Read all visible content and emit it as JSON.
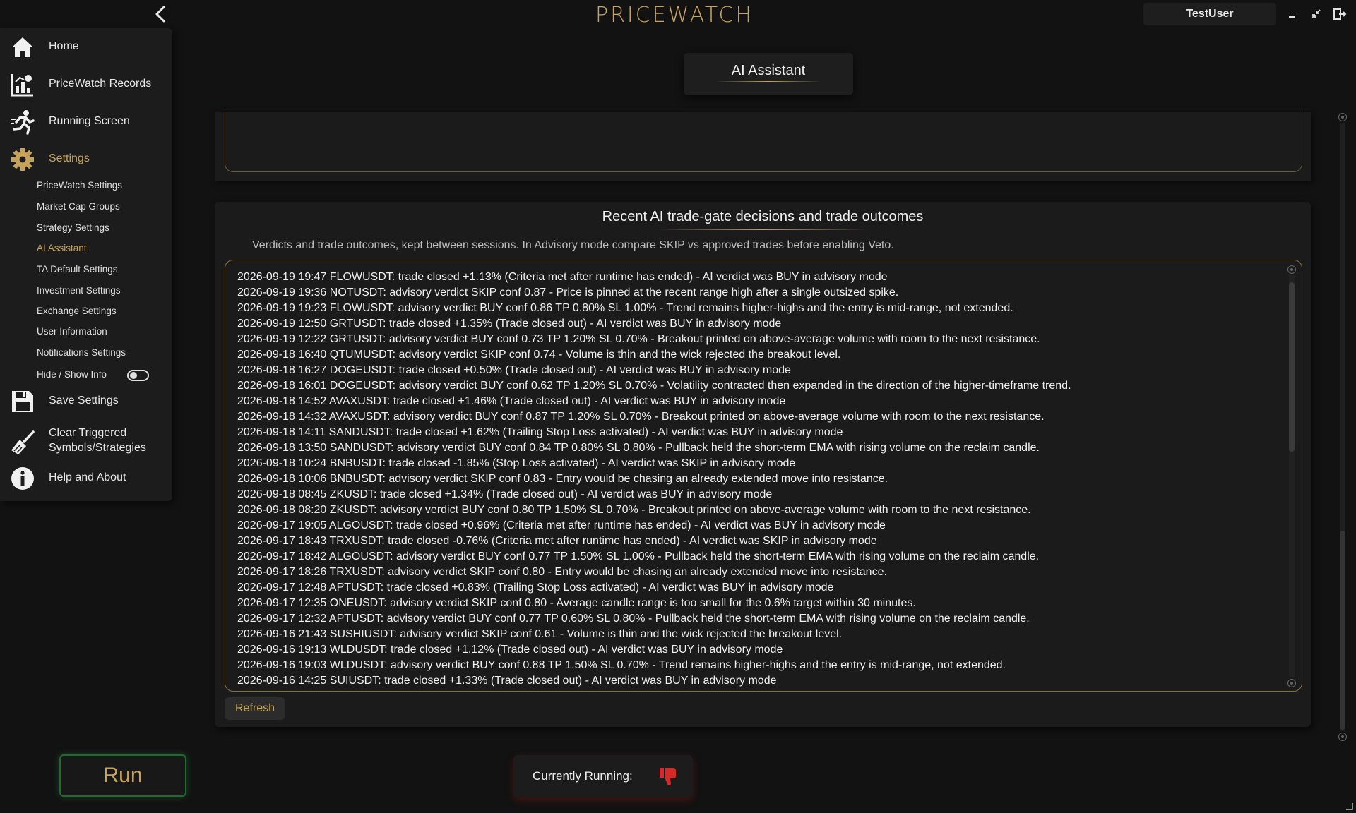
{
  "app": {
    "title": "PRICEWATCH",
    "user": "TestUser"
  },
  "sidebar": {
    "items": [
      {
        "label": "Home",
        "icon": "home-icon"
      },
      {
        "label": "PriceWatch Records",
        "icon": "records-chart-icon"
      },
      {
        "label": "Running Screen",
        "icon": "running-person-icon"
      },
      {
        "label": "Settings",
        "icon": "gear-icon"
      }
    ],
    "settings_subitems": [
      "PriceWatch Settings",
      "Market Cap Groups",
      "Strategy Settings",
      "AI Assistant",
      "TA Default Settings",
      "Investment Settings",
      "Exchange Settings",
      "User Information",
      "Notifications Settings"
    ],
    "active_subitem": "AI Assistant",
    "hide_show_label": "Hide / Show Info",
    "hide_show_state": "off",
    "save_label": "Save Settings",
    "clear_label_line1": "Clear Triggered",
    "clear_label_line2": "Symbols/Strategies",
    "help_label": "Help and About"
  },
  "page": {
    "title": "AI Assistant"
  },
  "log": {
    "title": "Recent AI trade-gate decisions and trade outcomes",
    "subtitle": "Verdicts and trade outcomes, kept between sessions. In Advisory mode compare SKIP vs approved trades before enabling Veto.",
    "lines": [
      "2026-09-19 19:47  FLOWUSDT: trade closed +1.13% (Criteria met after runtime has ended) - AI verdict was BUY in advisory mode",
      "2026-09-19 19:36  NOTUSDT: advisory verdict SKIP conf 0.87 - Price is pinned at the recent range high after a single outsized spike.",
      "2026-09-19 19:23  FLOWUSDT: advisory verdict BUY conf 0.86 TP 0.80% SL 1.00% - Trend remains higher-highs and the entry is mid-range, not extended.",
      "2026-09-19 12:50  GRTUSDT: trade closed +1.35% (Trade closed out) - AI verdict was BUY in advisory mode",
      "2026-09-19 12:22  GRTUSDT: advisory verdict BUY conf 0.73 TP 1.20% SL 0.70% - Breakout printed on above-average volume with room to the next resistance.",
      "2026-09-18 16:40  QTUMUSDT: advisory verdict SKIP conf 0.74 - Volume is thin and the wick rejected the breakout level.",
      "2026-09-18 16:27  DOGEUSDT: trade closed +0.50% (Trade closed out) - AI verdict was BUY in advisory mode",
      "2026-09-18 16:01  DOGEUSDT: advisory verdict BUY conf 0.62 TP 1.20% SL 0.70% - Volatility contracted then expanded in the direction of the higher-timeframe trend.",
      "2026-09-18 14:52  AVAXUSDT: trade closed +1.46% (Trade closed out) - AI verdict was BUY in advisory mode",
      "2026-09-18 14:32  AVAXUSDT: advisory verdict BUY conf 0.87 TP 1.20% SL 0.70% - Breakout printed on above-average volume with room to the next resistance.",
      "2026-09-18 14:11  SANDUSDT: trade closed +1.62% (Trailing Stop Loss activated) - AI verdict was BUY in advisory mode",
      "2026-09-18 13:50  SANDUSDT: advisory verdict BUY conf 0.84 TP 0.80% SL 0.80% - Pullback held the short-term EMA with rising volume on the reclaim candle.",
      "2026-09-18 10:24  BNBUSDT: trade closed -1.85% (Stop Loss activated) - AI verdict was SKIP in advisory mode",
      "2026-09-18 10:06  BNBUSDT: advisory verdict SKIP conf 0.83 - Entry would be chasing an already extended move into resistance.",
      "2026-09-18 08:45  ZKUSDT: trade closed +1.34% (Trade closed out) - AI verdict was BUY in advisory mode",
      "2026-09-18 08:20  ZKUSDT: advisory verdict BUY conf 0.80 TP 1.50% SL 0.70% - Breakout printed on above-average volume with room to the next resistance.",
      "2026-09-17 19:05  ALGOUSDT: trade closed +0.96% (Criteria met after runtime has ended) - AI verdict was BUY in advisory mode",
      "2026-09-17 18:43  TRXUSDT: trade closed -0.76% (Criteria met after runtime has ended) - AI verdict was SKIP in advisory mode",
      "2026-09-17 18:42  ALGOUSDT: advisory verdict BUY conf 0.77 TP 1.50% SL 1.00% - Pullback held the short-term EMA with rising volume on the reclaim candle.",
      "2026-09-17 18:26  TRXUSDT: advisory verdict SKIP conf 0.80 - Entry would be chasing an already extended move into resistance.",
      "2026-09-17 12:48  APTUSDT: trade closed +0.83% (Trailing Stop Loss activated) - AI verdict was BUY in advisory mode",
      "2026-09-17 12:35  ONEUSDT: advisory verdict SKIP conf 0.80 - Average candle range is too small for the 0.6% target within 30 minutes.",
      "2026-09-17 12:32  APTUSDT: advisory verdict BUY conf 0.77 TP 0.60% SL 0.80% - Pullback held the short-term EMA with rising volume on the reclaim candle.",
      "2026-09-16 21:43  SUSHIUSDT: advisory verdict SKIP conf 0.61 - Volume is thin and the wick rejected the breakout level.",
      "2026-09-16 19:13  WLDUSDT: trade closed +1.12% (Trade closed out) - AI verdict was BUY in advisory mode",
      "2026-09-16 19:03  WLDUSDT: advisory verdict BUY conf 0.88 TP 1.50% SL 0.70% - Trend remains higher-highs and the entry is mid-range, not extended.",
      "2026-09-16 14:25  SUIUSDT: trade closed +1.33% (Trade closed out) - AI verdict was BUY in advisory mode"
    ],
    "refresh_label": "Refresh"
  },
  "footer": {
    "run_label": "Run",
    "currently_running_label": "Currently Running:",
    "running_status_icon": "thumbs-down-icon"
  },
  "colors": {
    "accent_gold": "#c7a25a",
    "background": "#121212",
    "panel": "#1b1b1b",
    "run_border_green": "#1e6b2e",
    "status_red": "#d42a2a"
  }
}
